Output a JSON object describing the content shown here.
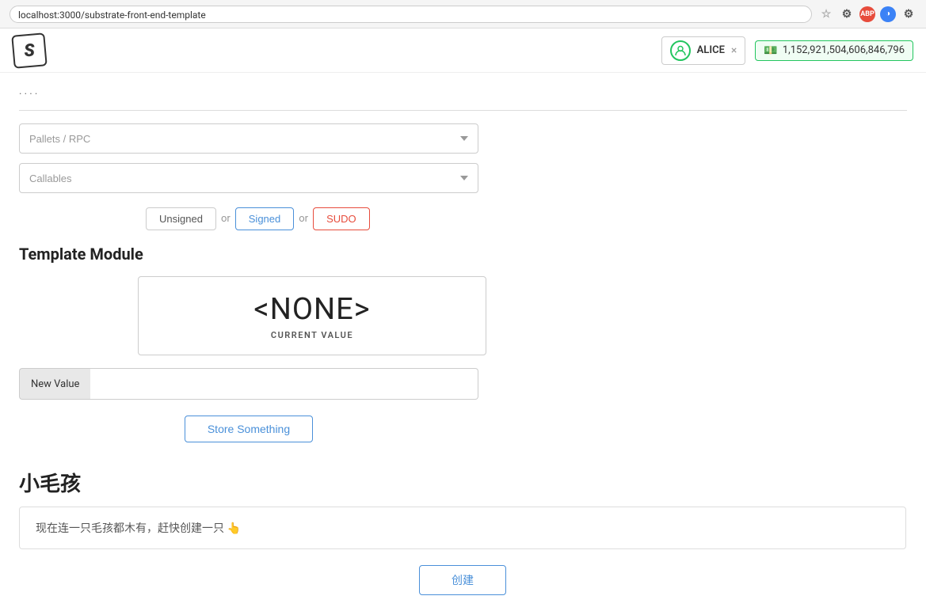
{
  "browser": {
    "url": "localhost:3000/substrate-front-end-template",
    "icons": {
      "star": "☆",
      "abp": "ABP",
      "ext1": "◑",
      "settings": "⚙"
    }
  },
  "header": {
    "logo": "S",
    "user": {
      "name": "ALICE",
      "close_label": "×"
    },
    "balance": {
      "value": "1,152,921,504,606,846,796",
      "icon": "💵"
    }
  },
  "tabs": [
    {
      "label": "·  ·  ·",
      "active": false
    }
  ],
  "pallets_dropdown": {
    "placeholder": "Pallets / RPC"
  },
  "callables_dropdown": {
    "placeholder": "Callables"
  },
  "tx_types": {
    "unsigned": "Unsigned",
    "or1": "or",
    "signed": "Signed",
    "or2": "or",
    "sudo": "SUDO"
  },
  "template_module": {
    "title": "Template Module",
    "current_value_display": "<NONE>",
    "current_value_label": "CURRENT VALUE",
    "new_value_label": "New Value",
    "new_value_placeholder": "",
    "store_button_label": "Store Something"
  },
  "xiao_section": {
    "title": "小毛孩",
    "empty_notice": "现在连一只毛孩都木有，赶快创建一只 👆",
    "create_button_label": "创建"
  }
}
